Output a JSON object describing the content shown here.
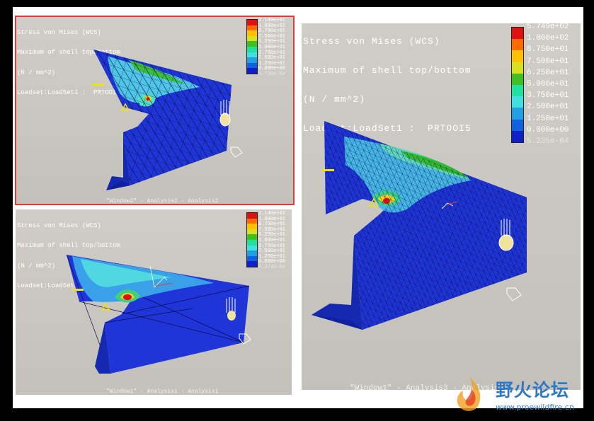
{
  "viewports": [
    {
      "header": [
        "Stress von Mises (WCS)",
        "Maximum of shell top/bottom",
        "(N / mm^2)",
        "Loadset:LoadSet1 :  PRTOOI5"
      ],
      "legend": [
        "2.189e+02",
        "1.000e+02",
        "8.750e+01",
        "7.500e+01",
        "6.250e+01",
        "5.000e+01",
        "3.750e+01",
        "2.500e+01",
        "1.250e+01",
        "0.000e+00",
        "1.750e-04"
      ],
      "footer": "\"Window2\" - Analysis2 - Analysis2",
      "selected": true
    },
    {
      "header": [
        "Stress von Mises (WCS)",
        "Maximum of shell top/bottom",
        "(N / mm^2)",
        "Loadset:LoadSet1 :  PRTOOI5"
      ],
      "legend": [
        "1.140e+02",
        "1.000e+02",
        "8.750e+01",
        "7.500e+01",
        "6.250e+01",
        "5.000e+01",
        "3.750e+01",
        "2.500e+01",
        "1.250e+01",
        "0.000e+00",
        "3.374e-04"
      ],
      "footer": "\"Window1\" - Analysis1 - Analysis1",
      "selected": false
    },
    {
      "header": [
        "Stress von Mises (WCS)",
        "Maximum of shell top/bottom",
        "(N / mm^2)",
        "Loadset:LoadSet1 :  PRTOOI5"
      ],
      "legend": [
        "5.749e+02",
        "1.000e+02",
        "8.750e+01",
        "7.500e+01",
        "6.250e+01",
        "5.000e+01",
        "3.750e+01",
        "2.500e+01",
        "1.250e+01",
        "0.000e+00",
        "5.235e-04"
      ],
      "footer": "\"Window1\" - Analysis3 - Analysis3",
      "selected": false
    }
  ],
  "legend_colors": [
    "#e01010",
    "#ff6a00",
    "#ffc000",
    "#d8e020",
    "#40c020",
    "#20e0a0",
    "#40e0e0",
    "#20a0e0",
    "#1060e0",
    "#1020c8",
    "#102090"
  ],
  "watermark": {
    "text": "野火论坛",
    "url": "www.proewildfire.cn"
  }
}
